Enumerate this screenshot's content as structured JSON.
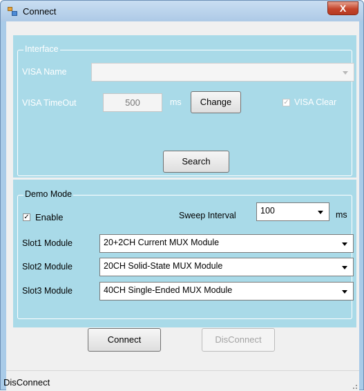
{
  "window": {
    "title": "Connect",
    "close_glyph": "X"
  },
  "interface": {
    "legend": "Interface",
    "visa_name_label": "VISA Name",
    "visa_name_value": "",
    "timeout_label": "VISA TimeOut",
    "timeout_value": "500",
    "timeout_unit": "ms",
    "change_label": "Change",
    "visa_clear_label": "VISA Clear",
    "visa_clear_checked": true,
    "search_label": "Search"
  },
  "demo": {
    "legend": "Demo Mode",
    "enable_label": "Enable",
    "enable_checked": true,
    "sweep_label": "Sweep Interval",
    "sweep_value": "100",
    "sweep_unit": "ms",
    "slots": [
      {
        "label": "Slot1 Module",
        "value": "20+2CH Current MUX Module"
      },
      {
        "label": "Slot2 Module",
        "value": "20CH Solid-State MUX Module"
      },
      {
        "label": "Slot3 Module",
        "value": "40CH Single-Ended MUX Module"
      }
    ]
  },
  "actions": {
    "connect_label": "Connect",
    "disconnect_label": "DisConnect"
  },
  "status": {
    "text": "DisConnect"
  },
  "icons": {
    "app": "app-window-icon",
    "close": "close-icon",
    "dropdown": "chevron-down-icon",
    "check": "checkbox-check-icon",
    "grip": "resize-grip-icon"
  },
  "colors": {
    "panel": "#a9dae8",
    "client": "#f0f0f0",
    "close": "#c4452c"
  }
}
